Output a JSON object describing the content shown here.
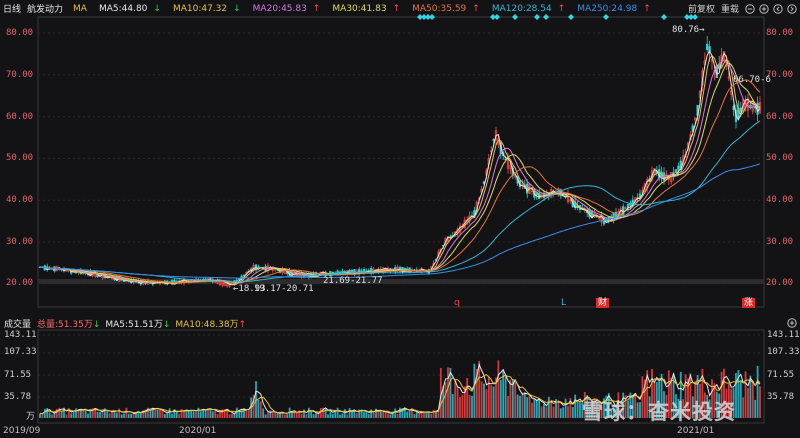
{
  "header": {
    "period": "日线",
    "stock_name": "航发动力",
    "ma_label": "MA",
    "ma": [
      {
        "label": "MA5:44.80",
        "arrow": "↓",
        "color": "#e8e8e8",
        "arrow_color": "#2fd14a"
      },
      {
        "label": "MA10:47.32",
        "arrow": "↓",
        "color": "#e8c23a",
        "arrow_color": "#2fd14a"
      },
      {
        "label": "MA20:45.83",
        "arrow": "↑",
        "color": "#d777e6",
        "arrow_color": "#ff4a4a"
      },
      {
        "label": "MA30:41.83",
        "arrow": "↑",
        "color": "#dddd55",
        "arrow_color": "#ff4a4a"
      },
      {
        "label": "MA50:35.59",
        "arrow": "↑",
        "color": "#e8763a",
        "arrow_color": "#ff4a4a"
      },
      {
        "label": "MA120:28.54",
        "arrow": "↑",
        "color": "#2fb8d8",
        "arrow_color": "#ff4a4a"
      },
      {
        "label": "MA250:24.98",
        "arrow": "↑",
        "color": "#3a8de8",
        "arrow_color": "#ff4a4a"
      }
    ],
    "adjust_label": "前复权",
    "overlay_label": "重载"
  },
  "price_axis": {
    "ticks": [
      "80.00",
      "70.00",
      "60.00",
      "50.00",
      "40.00",
      "30.00",
      "20.00"
    ]
  },
  "annotations": {
    "high": "80.76→",
    "high_right": "66.70-6",
    "low": "←18.93",
    "range1": "19.17-20.71",
    "range2": "21.69-21.77"
  },
  "event_tags": [
    {
      "text": "q",
      "color": "#ff3a3a",
      "bg": "transparent"
    },
    {
      "text": "L",
      "color": "#2fb8d8",
      "bg": "transparent"
    },
    {
      "text": "财",
      "color": "#ffffff",
      "bg": "#d82a2a"
    },
    {
      "text": "涨",
      "color": "#ffffff",
      "bg": "#d82a2a"
    }
  ],
  "volume": {
    "title": "成交量",
    "total": "总量:51.35万",
    "total_arrow": "↓",
    "ma5": "MA5:51.51万",
    "ma5_arrow": "↓",
    "ma10": "MA10:48.38万",
    "ma10_arrow": "↑",
    "ticks": [
      "143.11",
      "107.33",
      "71.55",
      "35.78",
      "万"
    ],
    "right_ticks": [
      "143.11",
      "107.33",
      "71.55",
      "35.78"
    ]
  },
  "dates": [
    "2019/09",
    "2020/01",
    "2021/01"
  ],
  "watermark": "雪球：杳米投资",
  "colors": {
    "up": "#ff4a4a",
    "down": "#2fd1d1",
    "background": "#131315"
  }
}
